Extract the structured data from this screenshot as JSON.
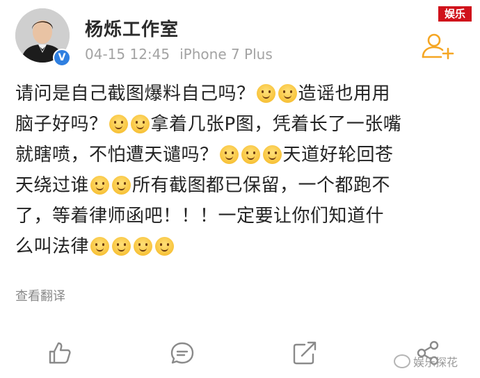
{
  "post": {
    "author": "杨烁工作室",
    "time": "04-15 12:45",
    "device": "iPhone 7 Plus",
    "verified_mark": "V",
    "follow_icon": "add-user-icon",
    "lines": [
      [
        "请问是自己截图爆料自己吗？",
        "emoji",
        "emoji",
        "造谣也用用"
      ],
      [
        "脑子好吗？",
        "emoji",
        "emoji",
        "拿着几张P图，凭着长了一张嘴"
      ],
      [
        "就瞎喷，不怕遭天谴吗？",
        "emoji",
        "emoji",
        "emoji",
        "天道好轮回苍"
      ],
      [
        "天绕过谁",
        "emoji",
        "emoji",
        "所有截图都已保留，一个都跑不"
      ],
      [
        "了，等着律师函吧！！！一定要让你们知道什"
      ],
      [
        "么叫法律",
        "emoji",
        "emoji",
        "emoji",
        "emoji"
      ]
    ],
    "translate_label": "查看翻译"
  },
  "watermark": {
    "tag": "娱乐",
    "source": "娱乐探花",
    "tag_color": "#d0121b"
  },
  "actions": [
    {
      "name": "like-icon"
    },
    {
      "name": "comment-icon"
    },
    {
      "name": "repost-icon"
    },
    {
      "name": "share-icon"
    }
  ],
  "colors": {
    "accent_orange": "#f5a623",
    "verified_blue": "#2f7fe0",
    "meta_gray": "#a3a3a3"
  }
}
